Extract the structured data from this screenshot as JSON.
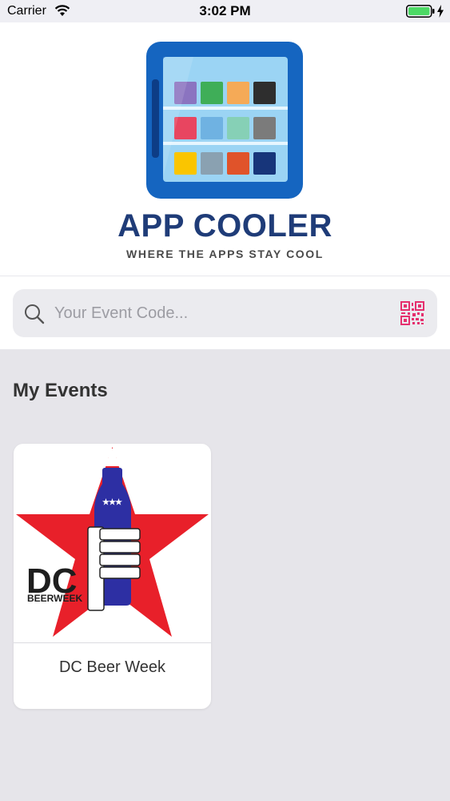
{
  "status_bar": {
    "carrier": "Carrier",
    "time": "3:02 PM",
    "wifi_icon": "wifi-icon",
    "battery_icon": "battery-full-icon",
    "charging_icon": "charging-bolt-icon"
  },
  "header": {
    "logo_title": "APP COOLER",
    "logo_tagline": "WHERE THE APPS STAY COOL",
    "logo_icon": "cooler-fridge-icon"
  },
  "search": {
    "placeholder": "Your Event Code...",
    "value": "",
    "search_icon": "search-icon",
    "qr_icon": "qr-code-icon"
  },
  "my_events": {
    "title": "My Events",
    "events": [
      {
        "name": "DC Beer Week",
        "logo_text": "DC",
        "logo_subtext": "BEERWEEK"
      }
    ]
  },
  "colors": {
    "brand_blue": "#1f3c78",
    "qr_accent": "#e5306e",
    "star_red": "#e8202a",
    "bottle_blue": "#2d2fa3",
    "background": "#e6e5ea",
    "battery_green": "#4cd964"
  }
}
